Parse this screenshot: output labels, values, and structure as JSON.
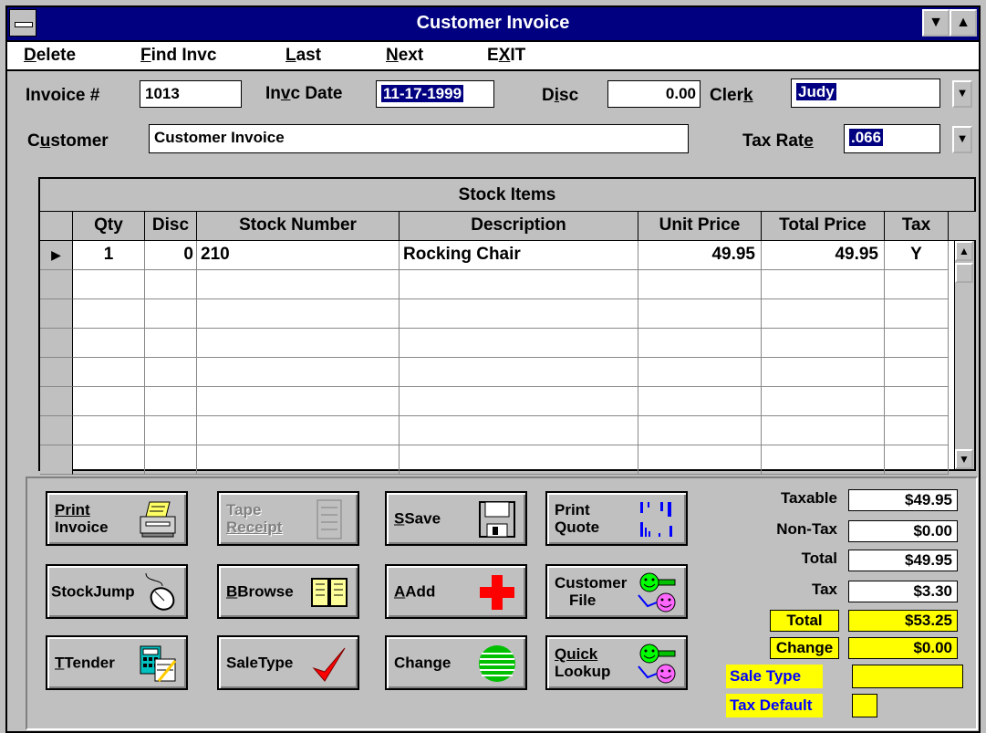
{
  "window": {
    "title": "Customer Invoice"
  },
  "menu": [
    {
      "pre": "",
      "ul": "D",
      "post": "elete"
    },
    {
      "pre": "",
      "ul": "F",
      "post": "ind Invc"
    },
    {
      "pre": "",
      "ul": "L",
      "post": "ast"
    },
    {
      "pre": "",
      "ul": "N",
      "post": "ext"
    },
    {
      "pre": "E",
      "ul": "X",
      "post": "IT"
    }
  ],
  "form": {
    "invoice_label": "Invoice #",
    "invoice_value": "1013",
    "date_label_pre": "In",
    "date_label_ul": "v",
    "date_label_post": "c Date",
    "date_value": "11-17-1999",
    "disc_label_pre": "D",
    "disc_label_ul": "i",
    "disc_label_post": "sc",
    "disc_value": "0.00",
    "clerk_label_pre": "Cler",
    "clerk_label_ul": "k",
    "clerk_value": "Judy",
    "customer_label_pre": "C",
    "customer_label_ul": "u",
    "customer_label_post": "stomer",
    "customer_value": "Customer Invoice",
    "taxrate_label_pre": "Tax Rat",
    "taxrate_label_ul": "e",
    "taxrate_value": ".066"
  },
  "grid": {
    "title": "Stock Items",
    "columns": [
      "Qty",
      "Disc",
      "Stock Number",
      "Description",
      "Unit Price",
      "Total Price",
      "Tax"
    ],
    "rows": [
      {
        "qty": "1",
        "disc": "0",
        "stock": "210",
        "desc": "Rocking Chair",
        "unit": "49.95",
        "total": "49.95",
        "tax": "Y"
      }
    ]
  },
  "buttons": {
    "print_invoice_1": "Print",
    "print_invoice_2": "Invoice",
    "tape_receipt_1": "Tape",
    "tape_receipt_2": "Receipt",
    "save": "Save",
    "print_quote_1": "Print",
    "print_quote_2": "Quote",
    "stockjump": "StockJump",
    "browse": "Browse",
    "add": "Add",
    "customer_file_1": "Customer",
    "customer_file_2": "File",
    "tender": "Tender",
    "saletype": "SaleType",
    "change": "Change",
    "quick_lookup_1": "Quick",
    "quick_lookup_2": "Lookup"
  },
  "summary": {
    "taxable_label": "Taxable",
    "taxable": "$49.95",
    "nontax_label": "Non-Tax",
    "nontax": "$0.00",
    "total_label": "Total",
    "total": "$49.95",
    "tax_label": "Tax",
    "tax": "$3.30",
    "grand_total_label": "Total",
    "grand_total": "$53.25",
    "change_label": "Change",
    "change": "$0.00",
    "sale_type_label": "Sale Type",
    "sale_type": "",
    "tax_default_label": "Tax Default",
    "tax_default": ""
  },
  "colors": {
    "titlebar": "#000080",
    "highlight": "#ffff00",
    "accent_blue": "#0000ff"
  }
}
